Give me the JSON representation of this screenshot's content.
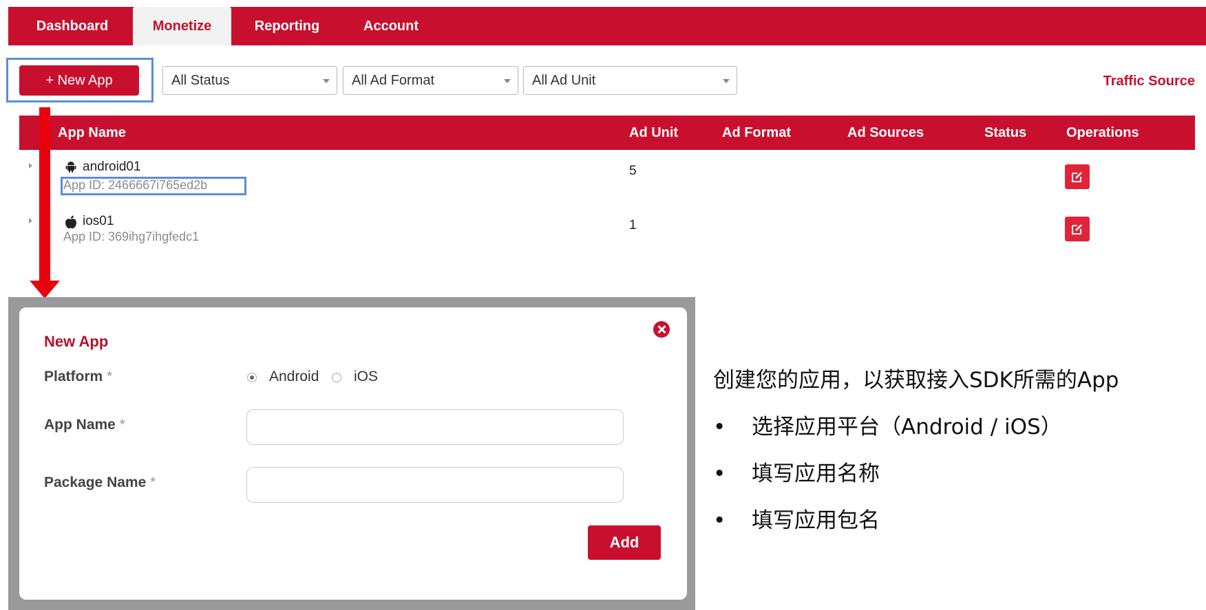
{
  "nav": {
    "tabs": [
      {
        "label": "Dashboard",
        "active": false
      },
      {
        "label": "Monetize",
        "active": true
      },
      {
        "label": "Reporting",
        "active": false
      },
      {
        "label": "Account",
        "active": false
      }
    ]
  },
  "toolbar": {
    "new_app_label": "+ New App",
    "status_select": "All Status",
    "format_select": "All Ad Format",
    "unit_select": "All Ad Unit",
    "traffic_source": "Traffic Source"
  },
  "table": {
    "headers": {
      "app_name": "App Name",
      "ad_unit": "Ad Unit",
      "ad_format": "Ad Format",
      "ad_sources": "Ad Sources",
      "status": "Status",
      "operations": "Operations"
    },
    "rows": [
      {
        "platform_icon": "android-icon",
        "name": "android01",
        "app_id": "App ID: 2466667i765ed2b",
        "ad_unit": "5"
      },
      {
        "platform_icon": "apple-icon",
        "name": "ios01",
        "app_id": "App ID: 369ihg7ihgfedc1",
        "ad_unit": "1"
      }
    ]
  },
  "modal": {
    "title": "New App",
    "platform_label": "Platform",
    "app_name_label": "App Name",
    "package_name_label": "Package Name",
    "required_mark": "*",
    "platform_options": [
      "Android",
      "iOS"
    ],
    "platform_selected": "Android",
    "app_name_value": "",
    "package_name_value": "",
    "add_label": "Add"
  },
  "annotation": {
    "title": "创建您的应用，以获取接入SDK所需的App",
    "bullet_char": "•",
    "bullets": [
      "选择应用平台（Android  / iOS）",
      "填写应用名称",
      "填写应用包名"
    ]
  },
  "colors": {
    "brand": "#c8102e",
    "highlight": "#5b8dd6",
    "arrow": "#e8000d"
  }
}
